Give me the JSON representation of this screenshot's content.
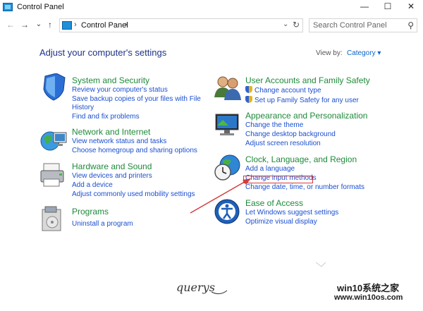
{
  "window": {
    "title": "Control Panel",
    "minimize": "—",
    "maximize": "☐",
    "close": "✕"
  },
  "nav": {
    "back": "←",
    "forward": "→",
    "recent": "⌄",
    "up": "↑",
    "breadcrumb": "Control Panel",
    "chevron": "›",
    "dropdown": "⌄",
    "refresh": "↻",
    "search_placeholder": "Search Control Panel",
    "search_glyph": "⚲"
  },
  "main": {
    "heading": "Adjust your computer's settings",
    "view_by_label": "View by:",
    "view_by_value": "Category ▾"
  },
  "categories": {
    "system": {
      "title": "System and Security",
      "links": [
        "Review your computer's status",
        "Save backup copies of your files with File",
        "History",
        "Find and fix problems"
      ]
    },
    "network": {
      "title": "Network and Internet",
      "links": [
        "View network status and tasks",
        "Choose homegroup and sharing options"
      ]
    },
    "hardware": {
      "title": "Hardware and Sound",
      "links": [
        "View devices and printers",
        "Add a device",
        "Adjust commonly used mobility settings"
      ]
    },
    "programs": {
      "title": "Programs",
      "links": [
        "Uninstall a program"
      ]
    },
    "users": {
      "title": "User Accounts and Family Safety",
      "links": [
        "Change account type",
        "Set up Family Safety for any user"
      ]
    },
    "appearance": {
      "title": "Appearance and Personalization",
      "links": [
        "Change the theme",
        "Change desktop background",
        "Adjust screen resolution"
      ]
    },
    "clock": {
      "title": "Clock, Language, and Region",
      "links": [
        "Add a language",
        "Change input methods",
        "Change date, time, or number formats"
      ]
    },
    "ease": {
      "title": "Ease of Access",
      "links": [
        "Let Windows suggest settings",
        "Optimize visual display"
      ]
    }
  },
  "watermark": {
    "signature": "querys",
    "logo": "win10系统之家",
    "url": "www.win10os.com"
  },
  "colors": {
    "heading": "#1e3287",
    "category_title": "#1e8a3a",
    "link": "#1a4fd0",
    "annotation": "#d43c3c"
  }
}
